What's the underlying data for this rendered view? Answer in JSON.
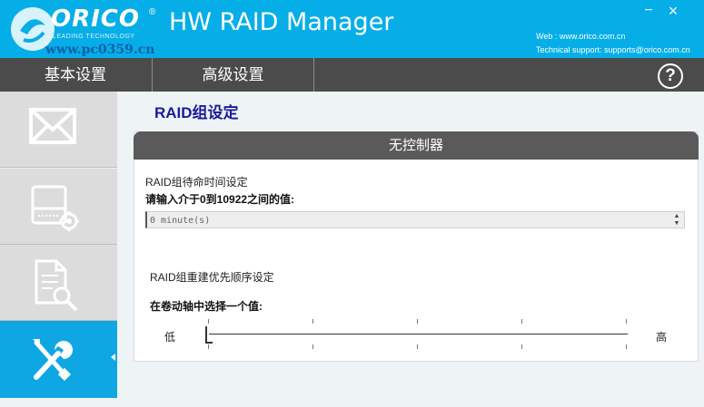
{
  "titlebar": {
    "brand": "ORICO",
    "brand_reg": "®",
    "tagline": "LEADING TECHNOLOGY",
    "app_title": "HW RAID Manager",
    "watermark": "www.pc0359.cn",
    "web": "Web : www.orico.com.cn",
    "support": "Technical support: supports@orico.com.cn",
    "minimize": "−",
    "close": "×",
    "accent_color": "#06aee8"
  },
  "tabs": [
    {
      "label": "基本设置"
    },
    {
      "label": "高级设置"
    }
  ],
  "help_label": "?",
  "sidebar": {
    "items": [
      {
        "icon": "mail-icon"
      },
      {
        "icon": "drive-settings-icon"
      },
      {
        "icon": "document-search-icon"
      },
      {
        "icon": "tools-icon",
        "selected": true
      }
    ],
    "selected_color": "#0ea7e3"
  },
  "main": {
    "page_title": "RAID组设定",
    "panel_title": "无控制器",
    "timeout_label": "RAID组待命时间设定",
    "timeout_prompt": "请输入介于0到10922之间的值:",
    "timeout_value": "0 minute(s)",
    "spin_up": "▲",
    "spin_down": "▼",
    "rebuild_label": "RAID组重建优先顺序设定",
    "rebuild_prompt": "在卷动轴中选择一个值:",
    "slider_low": "低",
    "slider_high": "高",
    "slider_value": 0
  }
}
